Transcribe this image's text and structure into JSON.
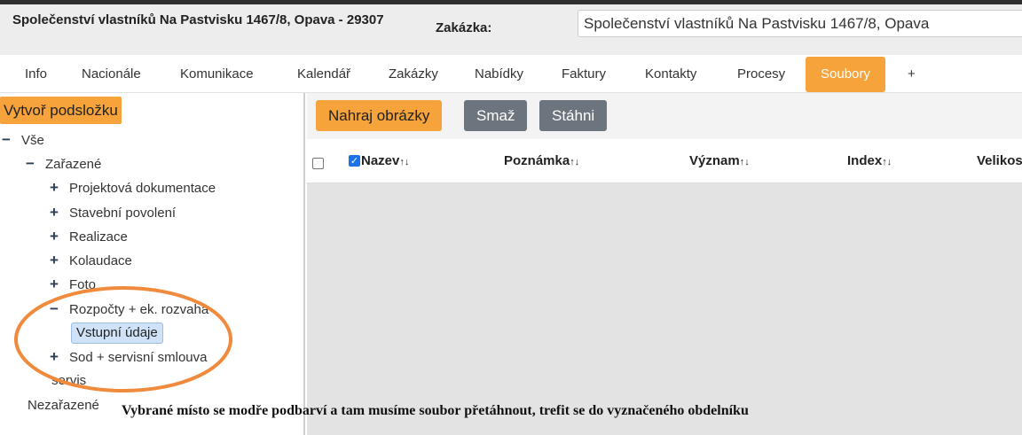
{
  "header": {
    "entity_name": "Společenství vlastníků Na Pastvisku 1467/8, Opava - 29307",
    "zakazka_label": "Zakázka:",
    "zakazka_value": "Společenství vlastníků Na Pastvisku 1467/8, Opava"
  },
  "tabs": [
    {
      "label": "Info"
    },
    {
      "label": "Nacionále"
    },
    {
      "label": "Komunikace"
    },
    {
      "label": "Kalendář"
    },
    {
      "label": "Zakázky"
    },
    {
      "label": "Nabídky"
    },
    {
      "label": "Faktury"
    },
    {
      "label": "Kontakty"
    },
    {
      "label": "Procesy"
    },
    {
      "label": "Soubory",
      "active": true
    },
    {
      "label": "+"
    }
  ],
  "sidebar": {
    "new_folder_label": "Vytvoř podsložku",
    "tree": {
      "root": {
        "toggle": "−",
        "label": "Vše"
      },
      "zarazene": {
        "toggle": "−",
        "label": "Zařazené"
      },
      "children": [
        {
          "toggle": "+",
          "label": "Projektová dokumentace"
        },
        {
          "toggle": "+",
          "label": "Stavební povolení"
        },
        {
          "toggle": "+",
          "label": "Realizace"
        },
        {
          "toggle": "+",
          "label": "Kolaudace"
        },
        {
          "toggle": "+",
          "label": "Foto"
        },
        {
          "toggle": "−",
          "label": "Rozpočty + ek. rozvaha"
        }
      ],
      "selected_sub": {
        "label": "Vstupní údaje"
      },
      "after": [
        {
          "toggle": "+",
          "label": "Sod + servisní smlouva"
        }
      ],
      "servis": {
        "label": "servis"
      },
      "nezarazene": {
        "label": "Nezařazené"
      }
    }
  },
  "toolbar": {
    "upload_label": "Nahraj obrázky",
    "delete_label": "Smaž",
    "download_label": "Stáhni"
  },
  "table": {
    "columns": [
      {
        "label": "Nazev"
      },
      {
        "label": "Poznámka"
      },
      {
        "label": "Význam"
      },
      {
        "label": "Index"
      },
      {
        "label": "Velikost"
      }
    ],
    "sort_glyph": "↑↓",
    "check_glyph": "✓"
  },
  "annotation": {
    "text": "Vybrané místo se modře podbarví a tam musíme soubor přetáhnout, trefit se do vyznačeného obdelníku",
    "color": "#f08a3c"
  },
  "colors": {
    "accent": "#f5a33a",
    "secondary_button": "#6c757d",
    "selected_node": "#cfe2f7"
  }
}
